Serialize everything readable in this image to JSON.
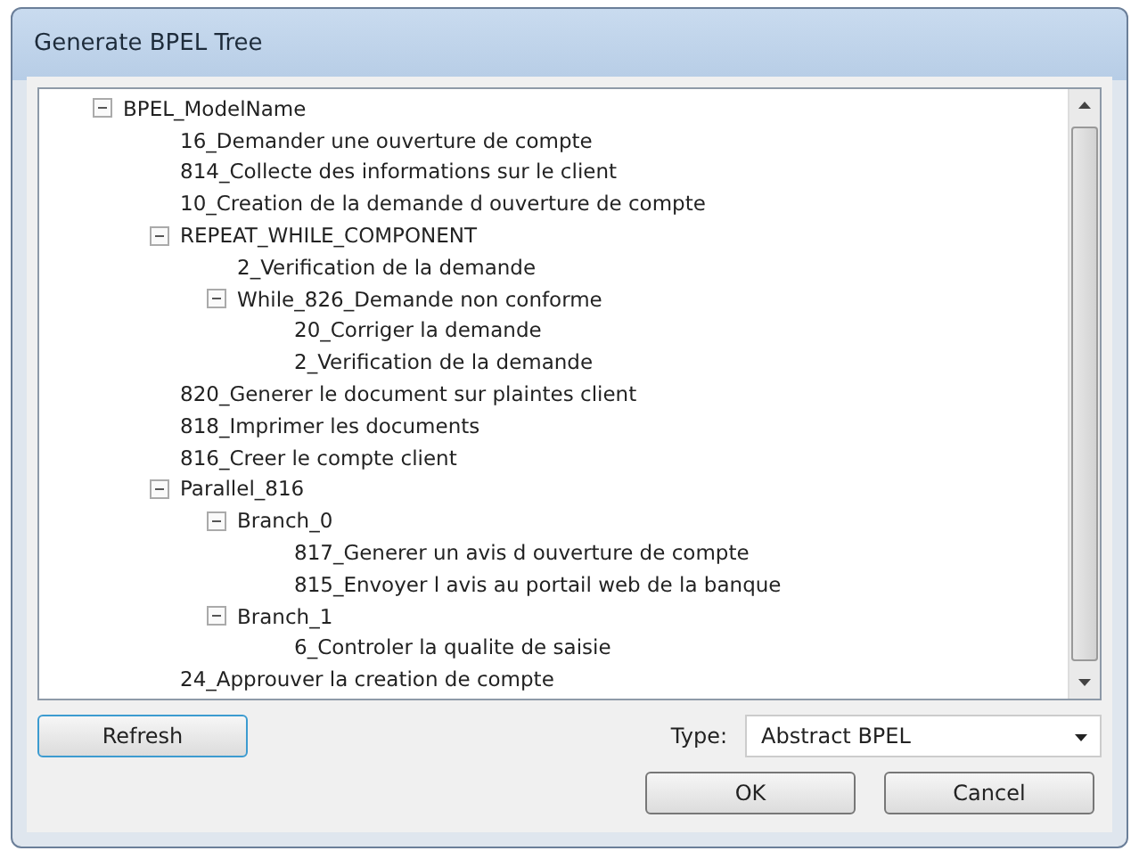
{
  "window": {
    "title": "Generate BPEL Tree"
  },
  "tree": [
    {
      "label": "BPEL_ModelName",
      "expanded": true,
      "children": [
        {
          "label": "16_Demander une ouverture de compte"
        },
        {
          "label": "814_Collecte des informations sur le client"
        },
        {
          "label": "10_Creation de la demande d ouverture de compte"
        },
        {
          "label": "REPEAT_WHILE_COMPONENT",
          "expanded": true,
          "children": [
            {
              "label": "2_Verification de la demande"
            },
            {
              "label": "While_826_Demande non conforme",
              "expanded": true,
              "children": [
                {
                  "label": "20_Corriger la demande"
                },
                {
                  "label": "2_Verification de la demande"
                }
              ]
            }
          ]
        },
        {
          "label": "820_Generer le document sur plaintes client"
        },
        {
          "label": "818_Imprimer les documents"
        },
        {
          "label": "816_Creer le compte client"
        },
        {
          "label": "Parallel_816",
          "expanded": true,
          "children": [
            {
              "label": "Branch_0",
              "expanded": true,
              "children": [
                {
                  "label": "817_Generer un avis d ouverture de compte"
                },
                {
                  "label": "815_Envoyer l avis au portail web de la banque"
                }
              ]
            },
            {
              "label": "Branch_1",
              "expanded": true,
              "children": [
                {
                  "label": "6_Controler la qualite de saisie"
                }
              ]
            }
          ]
        },
        {
          "label": "24_Approuver la creation de compte"
        }
      ]
    }
  ],
  "refresh_button": "Refresh",
  "type_field": {
    "label": "Type:",
    "value": "Abstract BPEL"
  },
  "buttons": [
    "OK",
    "Cancel"
  ]
}
